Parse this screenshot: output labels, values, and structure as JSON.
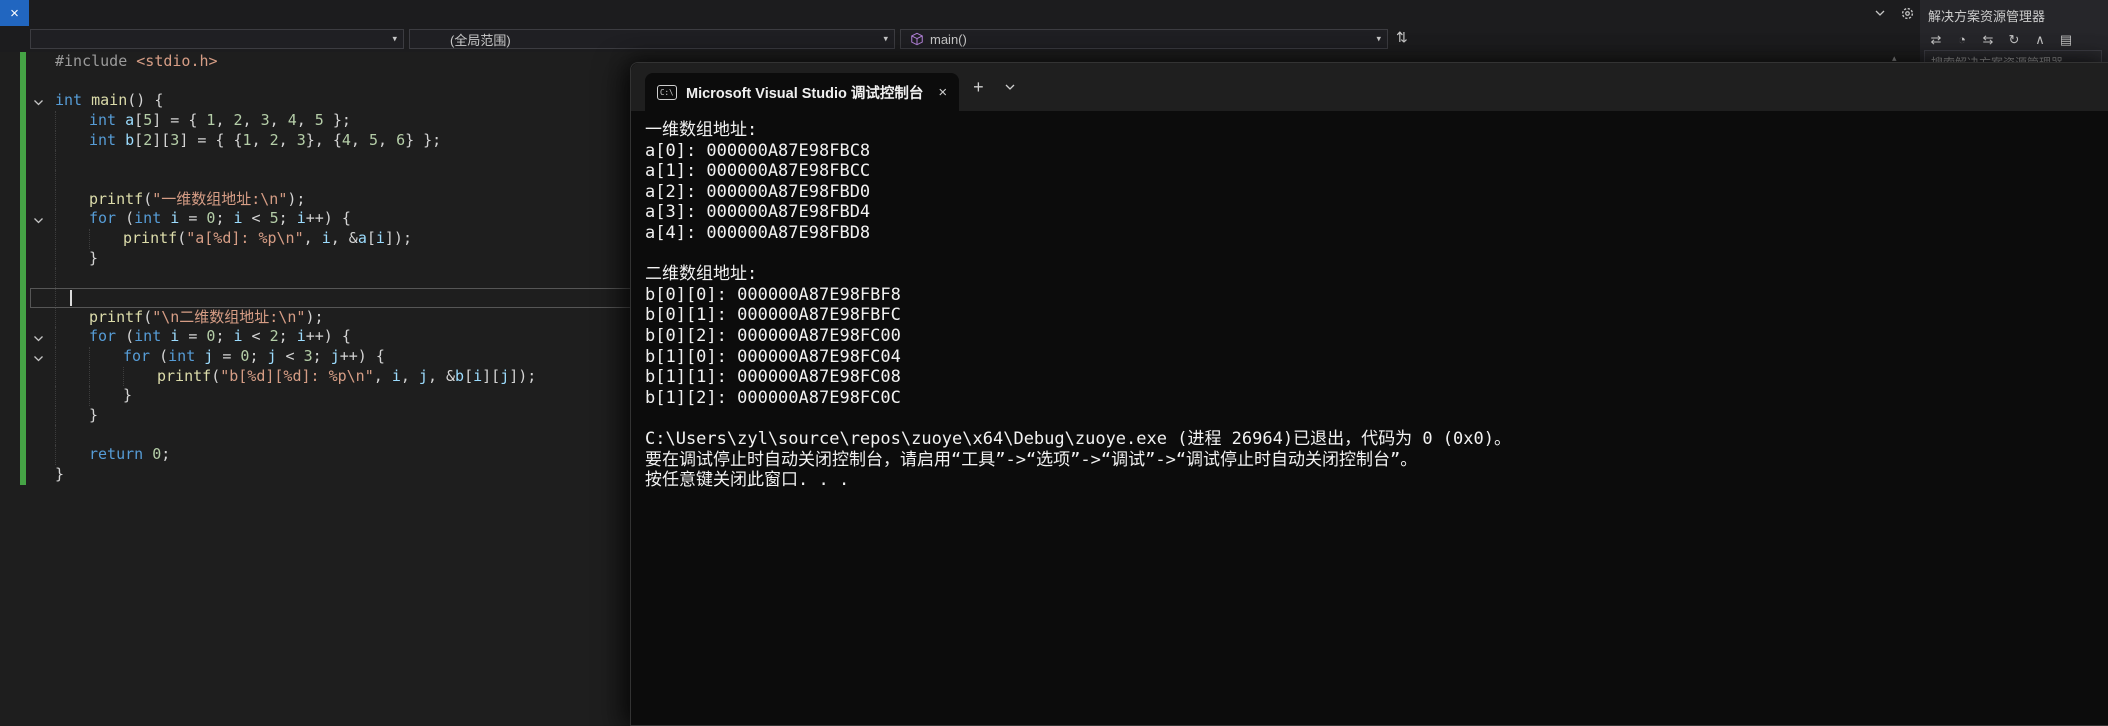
{
  "colors": {
    "editor_bg": "#1e1e1e",
    "console_bg": "#0c0c0c",
    "titlebar_bg": "#1c1c1e",
    "accent_blue": "#2166c0",
    "change_bar_green": "#45a345",
    "keyword": "#569cd6",
    "string": "#d69d85",
    "number": "#b5cea8",
    "identifier": "#9cdcfe",
    "function": "#dcdcaa",
    "preprocessor": "#9b9b9b"
  },
  "icons": {
    "close": "×",
    "dropdown_arrow": "▾",
    "plus": "+",
    "caret_up": "▴",
    "nav_toggle": "⇅",
    "console_icon_label": "C:\\"
  },
  "navbar": {
    "project": "",
    "scope": "(全局范围)",
    "member": "main()"
  },
  "solution_explorer": {
    "title": "解决方案资源管理器",
    "search_placeholder": "搜索解决方案资源管理器",
    "toolbar_icons": [
      {
        "name": "sync-with-active-document-icon",
        "glyph": "⇄"
      },
      {
        "name": "pending-changes-filter-icon",
        "glyph": "◔"
      },
      {
        "name": "switch-views-icon",
        "glyph": "⇆"
      },
      {
        "name": "refresh-icon",
        "glyph": "↻"
      },
      {
        "name": "collapse-all-icon",
        "glyph": "∧"
      },
      {
        "name": "show-all-files-icon",
        "glyph": "▤"
      }
    ]
  },
  "editor": {
    "cursor_line_index": 12,
    "lines": [
      {
        "tok": [
          [
            "pp",
            "#include "
          ],
          [
            "str",
            "<stdio.h>"
          ]
        ]
      },
      {
        "ind": 0
      },
      {
        "fold": true,
        "tok": [
          [
            "kw",
            "int"
          ],
          [
            "pl",
            " "
          ],
          [
            "fn",
            "main"
          ],
          [
            "pl",
            "() {"
          ]
        ]
      },
      {
        "ind": 1,
        "tok": [
          [
            "kw",
            "int"
          ],
          [
            "pl",
            " "
          ],
          [
            "var",
            "a"
          ],
          [
            "pl",
            "["
          ],
          [
            "num",
            "5"
          ],
          [
            "pl",
            "] = { "
          ],
          [
            "num",
            "1"
          ],
          [
            "pl",
            ", "
          ],
          [
            "num",
            "2"
          ],
          [
            "pl",
            ", "
          ],
          [
            "num",
            "3"
          ],
          [
            "pl",
            ", "
          ],
          [
            "num",
            "4"
          ],
          [
            "pl",
            ", "
          ],
          [
            "num",
            "5"
          ],
          [
            "pl",
            " };"
          ]
        ]
      },
      {
        "ind": 1,
        "tok": [
          [
            "kw",
            "int"
          ],
          [
            "pl",
            " "
          ],
          [
            "var",
            "b"
          ],
          [
            "pl",
            "["
          ],
          [
            "num",
            "2"
          ],
          [
            "pl",
            "]["
          ],
          [
            "num",
            "3"
          ],
          [
            "pl",
            "] = { {"
          ],
          [
            "num",
            "1"
          ],
          [
            "pl",
            ", "
          ],
          [
            "num",
            "2"
          ],
          [
            "pl",
            ", "
          ],
          [
            "num",
            "3"
          ],
          [
            "pl",
            "}, {"
          ],
          [
            "num",
            "4"
          ],
          [
            "pl",
            ", "
          ],
          [
            "num",
            "5"
          ],
          [
            "pl",
            ", "
          ],
          [
            "num",
            "6"
          ],
          [
            "pl",
            "} };"
          ]
        ]
      },
      {
        "ind": 1
      },
      {
        "ind": 1
      },
      {
        "ind": 1,
        "tok": [
          [
            "fn",
            "printf"
          ],
          [
            "pl",
            "("
          ],
          [
            "str",
            "\"一维数组地址:\\n\""
          ],
          [
            "pl",
            ");"
          ]
        ]
      },
      {
        "ind": 1,
        "fold": true,
        "tok": [
          [
            "kw",
            "for"
          ],
          [
            "pl",
            " ("
          ],
          [
            "kw",
            "int"
          ],
          [
            "pl",
            " "
          ],
          [
            "var",
            "i"
          ],
          [
            "pl",
            " = "
          ],
          [
            "num",
            "0"
          ],
          [
            "pl",
            "; "
          ],
          [
            "var",
            "i"
          ],
          [
            "pl",
            " < "
          ],
          [
            "num",
            "5"
          ],
          [
            "pl",
            "; "
          ],
          [
            "var",
            "i"
          ],
          [
            "pl",
            "++) {"
          ]
        ]
      },
      {
        "ind": 2,
        "tok": [
          [
            "fn",
            "printf"
          ],
          [
            "pl",
            "("
          ],
          [
            "str",
            "\"a[%d]: %p\\n\""
          ],
          [
            "pl",
            ", "
          ],
          [
            "var",
            "i"
          ],
          [
            "pl",
            ", &"
          ],
          [
            "var",
            "a"
          ],
          [
            "pl",
            "["
          ],
          [
            "var",
            "i"
          ],
          [
            "pl",
            "]);"
          ]
        ]
      },
      {
        "ind": 1,
        "tok": [
          [
            "pl",
            "}"
          ]
        ]
      },
      {
        "ind": 1
      },
      {
        "ind": 1
      },
      {
        "ind": 1,
        "tok": [
          [
            "fn",
            "printf"
          ],
          [
            "pl",
            "("
          ],
          [
            "str",
            "\"\\n二维数组地址:\\n\""
          ],
          [
            "pl",
            ");"
          ]
        ]
      },
      {
        "ind": 1,
        "fold": true,
        "tok": [
          [
            "kw",
            "for"
          ],
          [
            "pl",
            " ("
          ],
          [
            "kw",
            "int"
          ],
          [
            "pl",
            " "
          ],
          [
            "var",
            "i"
          ],
          [
            "pl",
            " = "
          ],
          [
            "num",
            "0"
          ],
          [
            "pl",
            "; "
          ],
          [
            "var",
            "i"
          ],
          [
            "pl",
            " < "
          ],
          [
            "num",
            "2"
          ],
          [
            "pl",
            "; "
          ],
          [
            "var",
            "i"
          ],
          [
            "pl",
            "++) {"
          ]
        ]
      },
      {
        "ind": 2,
        "fold": true,
        "tok": [
          [
            "kw",
            "for"
          ],
          [
            "pl",
            " ("
          ],
          [
            "kw",
            "int"
          ],
          [
            "pl",
            " "
          ],
          [
            "var",
            "j"
          ],
          [
            "pl",
            " = "
          ],
          [
            "num",
            "0"
          ],
          [
            "pl",
            "; "
          ],
          [
            "var",
            "j"
          ],
          [
            "pl",
            " < "
          ],
          [
            "num",
            "3"
          ],
          [
            "pl",
            "; "
          ],
          [
            "var",
            "j"
          ],
          [
            "pl",
            "++) {"
          ]
        ]
      },
      {
        "ind": 3,
        "tok": [
          [
            "fn",
            "printf"
          ],
          [
            "pl",
            "("
          ],
          [
            "str",
            "\"b[%d][%d]: %p\\n\""
          ],
          [
            "pl",
            ", "
          ],
          [
            "var",
            "i"
          ],
          [
            "pl",
            ", "
          ],
          [
            "var",
            "j"
          ],
          [
            "pl",
            ", &"
          ],
          [
            "var",
            "b"
          ],
          [
            "pl",
            "["
          ],
          [
            "var",
            "i"
          ],
          [
            "pl",
            "]["
          ],
          [
            "var",
            "j"
          ],
          [
            "pl",
            "]);"
          ]
        ]
      },
      {
        "ind": 2,
        "tok": [
          [
            "pl",
            "}"
          ]
        ]
      },
      {
        "ind": 1,
        "tok": [
          [
            "pl",
            "}"
          ]
        ]
      },
      {
        "ind": 1
      },
      {
        "ind": 1,
        "tok": [
          [
            "kw",
            "return"
          ],
          [
            "pl",
            " "
          ],
          [
            "num",
            "0"
          ],
          [
            "pl",
            ";"
          ]
        ]
      },
      {
        "tok": [
          [
            "pl",
            "}"
          ]
        ]
      }
    ]
  },
  "console": {
    "tab_title": "Microsoft Visual Studio 调试控制台",
    "lines": [
      "一维数组地址:",
      "a[0]: 000000A87E98FBC8",
      "a[1]: 000000A87E98FBCC",
      "a[2]: 000000A87E98FBD0",
      "a[3]: 000000A87E98FBD4",
      "a[4]: 000000A87E98FBD8",
      "",
      "二维数组地址:",
      "b[0][0]: 000000A87E98FBF8",
      "b[0][1]: 000000A87E98FBFC",
      "b[0][2]: 000000A87E98FC00",
      "b[1][0]: 000000A87E98FC04",
      "b[1][1]: 000000A87E98FC08",
      "b[1][2]: 000000A87E98FC0C",
      "",
      "C:\\Users\\zyl\\source\\repos\\zuoye\\x64\\Debug\\zuoye.exe (进程 26964)已退出，代码为 0 (0x0)。",
      "要在调试停止时自动关闭控制台，请启用“工具”->“选项”->“调试”->“调试停止时自动关闭控制台”。",
      "按任意键关闭此窗口. . ."
    ]
  }
}
